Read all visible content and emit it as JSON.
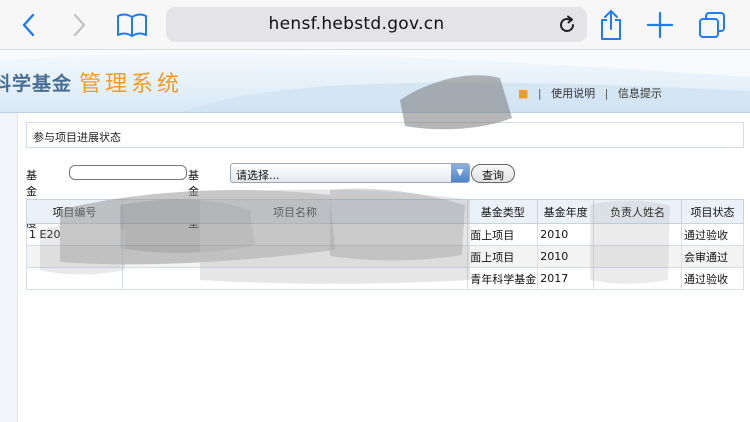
{
  "browser": {
    "url": "hensf.hebstd.gov.cn"
  },
  "banner": {
    "title_left": "科学基金",
    "title_right": "管理系统",
    "links": [
      "使用说明",
      "信息提示"
    ]
  },
  "section": {
    "title": "参与项目进展状态"
  },
  "search": {
    "year_label": "基金年度",
    "year_value": "",
    "type_label": "基金类型",
    "type_selected": "请选择...",
    "query_label": "查询"
  },
  "table": {
    "headers": [
      "项目编号",
      "项目名称",
      "基金类型",
      "基金年度",
      "负责人姓名",
      "项目状态"
    ],
    "rows": [
      {
        "index": "1",
        "code": "E20",
        "name": "",
        "type": "面上项目",
        "year": "2010",
        "leader": "",
        "status": "通过验收"
      },
      {
        "index": "",
        "code": "",
        "name": "",
        "type": "面上项目",
        "year": "2010",
        "leader": "",
        "status": "会审通过"
      },
      {
        "index": "",
        "code": "",
        "name": "",
        "type": "青年科学基金",
        "year": "2017",
        "leader": "",
        "status": "通过验收"
      }
    ]
  },
  "colors": {
    "banner_orange": "#f29a26",
    "banner_blue": "#4a6d93",
    "header_bg": "#ebf1f8"
  }
}
